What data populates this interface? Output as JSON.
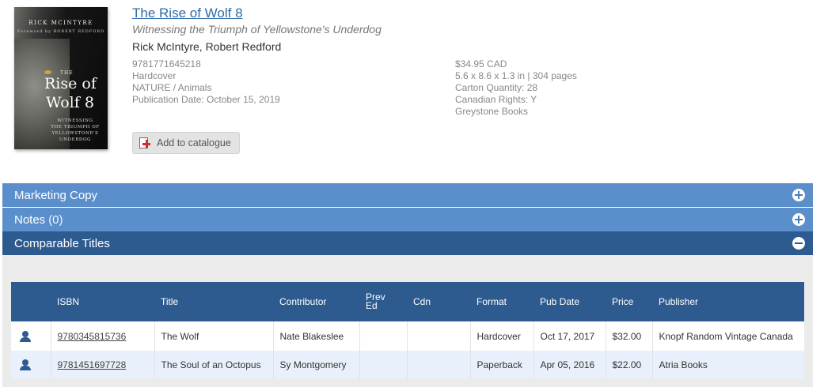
{
  "book": {
    "title": "The Rise of Wolf 8",
    "subtitle": "Witnessing the Triumph of Yellowstone's Underdog",
    "contributors": "Rick McIntyre, Robert Redford",
    "cover": {
      "author": "RICK MCINTYRE",
      "foreword": "Foreword by ROBERT REDFORD",
      "the": "THE",
      "title_line1": "Rise of",
      "title_line2": "Wolf 8",
      "sub_line1": "WITNESSING",
      "sub_line2": "THE TRIUMPH OF",
      "sub_line3": "YELLOWSTONE'S",
      "sub_line4": "UNDERDOG"
    },
    "isbn": "9781771645218",
    "format": "Hardcover",
    "category": "NATURE / Animals",
    "publication_date": "Publication Date: October 15, 2019",
    "price": "$34.95 CAD",
    "dimensions": "5.6 x 8.6 x 1.3 in | 304 pages",
    "carton_quantity": "Carton Quantity: 28",
    "rights": "Canadian Rights: Y",
    "publisher": "Greystone Books",
    "add_button_label": "Add to catalogue"
  },
  "sections": {
    "marketing": {
      "label": "Marketing Copy"
    },
    "notes": {
      "label": "Notes",
      "count": "(0)"
    },
    "comparable": {
      "label": "Comparable Titles"
    }
  },
  "comparable_table": {
    "headers": {
      "isbn": "ISBN",
      "title": "Title",
      "contributor": "Contributor",
      "prev_ed_1": "Prev",
      "prev_ed_2": "Ed",
      "cdn": "Cdn",
      "format": "Format",
      "pub_date": "Pub Date",
      "price": "Price",
      "publisher": "Publisher"
    },
    "rows": [
      {
        "isbn": "9780345815736",
        "title": "The Wolf",
        "contributor": "Nate Blakeslee",
        "prev_ed": "",
        "cdn": "",
        "format": "Hardcover",
        "pub_date": "Oct 17, 2017",
        "price": "$32.00",
        "publisher": "Knopf Random Vintage Canada"
      },
      {
        "isbn": "9781451697728",
        "title": "The Soul of an Octopus",
        "contributor": "Sy Montgomery",
        "prev_ed": "",
        "cdn": "",
        "format": "Paperback",
        "pub_date": "Apr 05, 2016",
        "price": "$22.00",
        "publisher": "Atria Books"
      }
    ]
  },
  "colors": {
    "bar_light": "#5b8fcc",
    "bar_dark": "#2e5b8f",
    "link": "#2d6ca8",
    "add_icon_plus": "#d6262e"
  },
  "icons": {
    "expand": "plus-circle-icon",
    "collapse": "minus-circle-icon",
    "row": "person-icon",
    "add": "catalogue-add-icon"
  }
}
